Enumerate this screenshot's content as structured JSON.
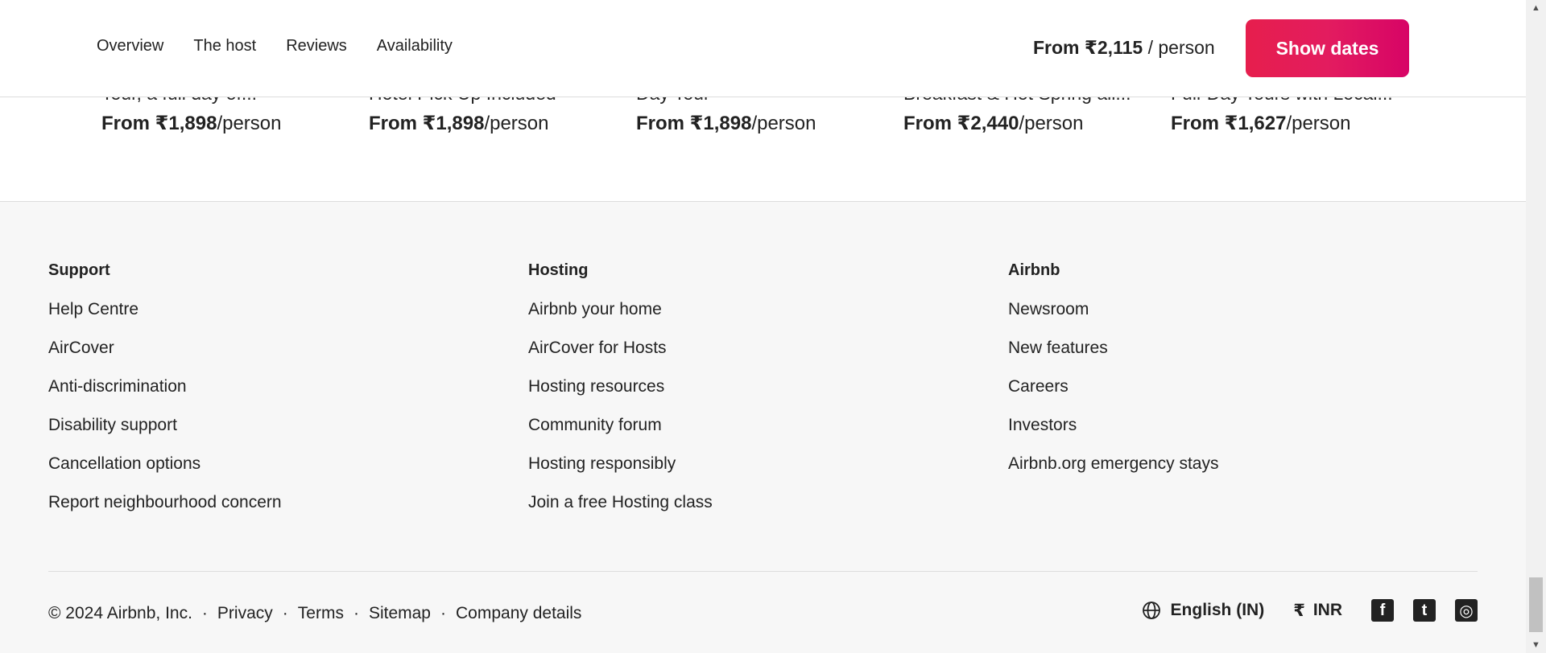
{
  "header": {
    "nav": [
      {
        "label": "Overview"
      },
      {
        "label": "The host"
      },
      {
        "label": "Reviews"
      },
      {
        "label": "Availability"
      }
    ],
    "price_bold": "From ₹2,115",
    "price_unit": " / person",
    "cta_label": "Show dates"
  },
  "cards": [
    {
      "title": "Tour, a full day of...",
      "price": "From ₹1,898",
      "unit": "/person"
    },
    {
      "title": "Hotel Pick Up Included",
      "price": "From ₹1,898",
      "unit": "/person"
    },
    {
      "title": "Day Tour",
      "price": "From ₹1,898",
      "unit": "/person"
    },
    {
      "title": "Breakfast & Hot Spring all...",
      "price": "From ₹2,440",
      "unit": "/person"
    },
    {
      "title": "Full-Day Tours with Local...",
      "price": "From ₹1,627",
      "unit": "/person"
    }
  ],
  "footer": {
    "columns": [
      {
        "title": "Support",
        "links": [
          "Help Centre",
          "AirCover",
          "Anti-discrimination",
          "Disability support",
          "Cancellation options",
          "Report neighbourhood concern"
        ]
      },
      {
        "title": "Hosting",
        "links": [
          "Airbnb your home",
          "AirCover for Hosts",
          "Hosting resources",
          "Community forum",
          "Hosting responsibly",
          "Join a free Hosting class"
        ]
      },
      {
        "title": "Airbnb",
        "links": [
          "Newsroom",
          "New features",
          "Careers",
          "Investors",
          "Airbnb.org emergency stays"
        ]
      }
    ],
    "copyright": "© 2024 Airbnb, Inc.",
    "separator": "·",
    "legal_links": [
      "Privacy",
      "Terms",
      "Sitemap",
      "Company details"
    ],
    "language": "English (IN)",
    "currency_symbol": "₹",
    "currency": "INR",
    "social": [
      {
        "icon": "facebook-icon",
        "glyph": "f"
      },
      {
        "icon": "twitter-icon",
        "glyph": "t"
      },
      {
        "icon": "instagram-icon",
        "glyph": "◎"
      }
    ]
  },
  "colors": {
    "brand": "#e31c5f",
    "text": "#222222",
    "footer_bg": "#f7f7f7",
    "border": "#dddddd"
  },
  "scrollbar": {
    "up_icon": "scroll-up-arrow-icon",
    "down_icon": "scroll-down-arrow-icon"
  }
}
